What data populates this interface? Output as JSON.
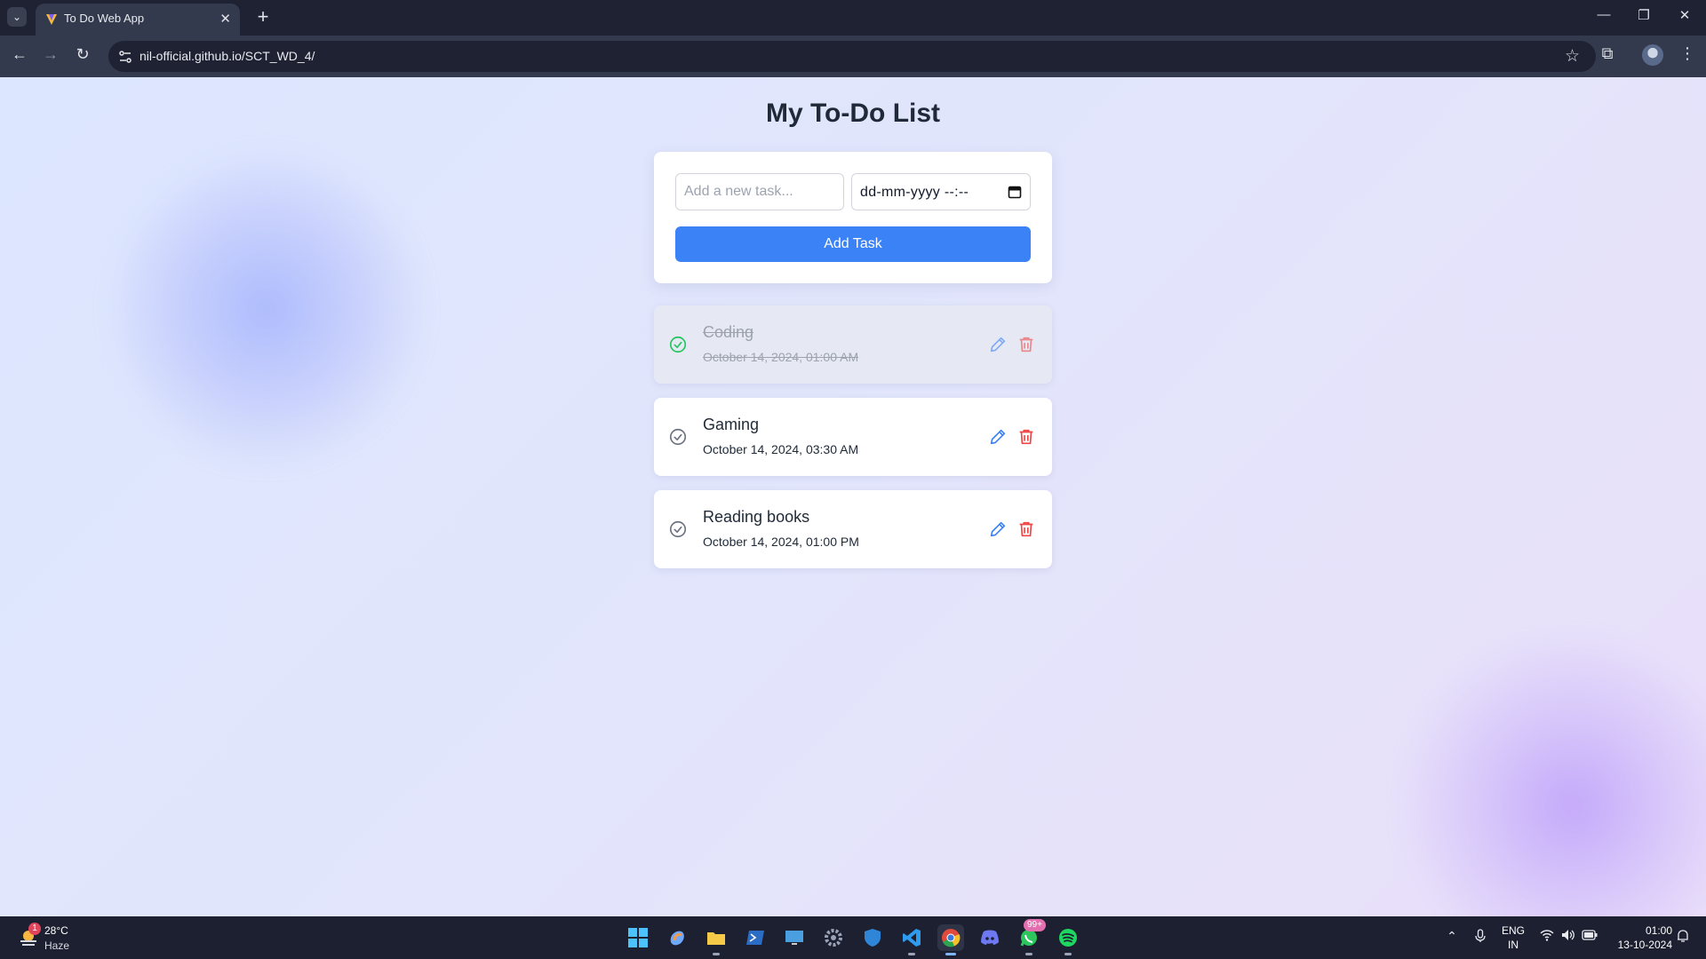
{
  "browser": {
    "tab_title": "To Do Web App",
    "url": "nil-official.github.io/SCT_WD_4/"
  },
  "page": {
    "title": "My To-Do List",
    "task_input_placeholder": "Add a new task...",
    "date_placeholder": "dd-mm-yyyy --:--",
    "add_button": "Add Task"
  },
  "tasks": [
    {
      "name": "Coding",
      "datetime": "October 14, 2024, 01:00 AM",
      "completed": true
    },
    {
      "name": "Gaming",
      "datetime": "October 14, 2024, 03:30 AM",
      "completed": false
    },
    {
      "name": "Reading books",
      "datetime": "October 14, 2024, 01:00 PM",
      "completed": false
    }
  ],
  "colors": {
    "primary": "#3b82f6",
    "delete": "#ef4444",
    "complete": "#22c55e",
    "text": "#1f2937"
  },
  "taskbar": {
    "weather_badge": "1",
    "weather_temp": "28°C",
    "weather_condition": "Haze",
    "whatsapp_badge": "99+",
    "language": "ENG",
    "region": "IN",
    "time": "01:00",
    "date": "13-10-2024",
    "apps": [
      "start-icon",
      "copilot-icon",
      "file-explorer-icon",
      "powershell-icon",
      "remote-desktop-icon",
      "settings-icon",
      "windows-security-icon",
      "vscode-icon",
      "chrome-icon",
      "discord-icon",
      "whatsapp-icon",
      "spotify-icon"
    ]
  }
}
